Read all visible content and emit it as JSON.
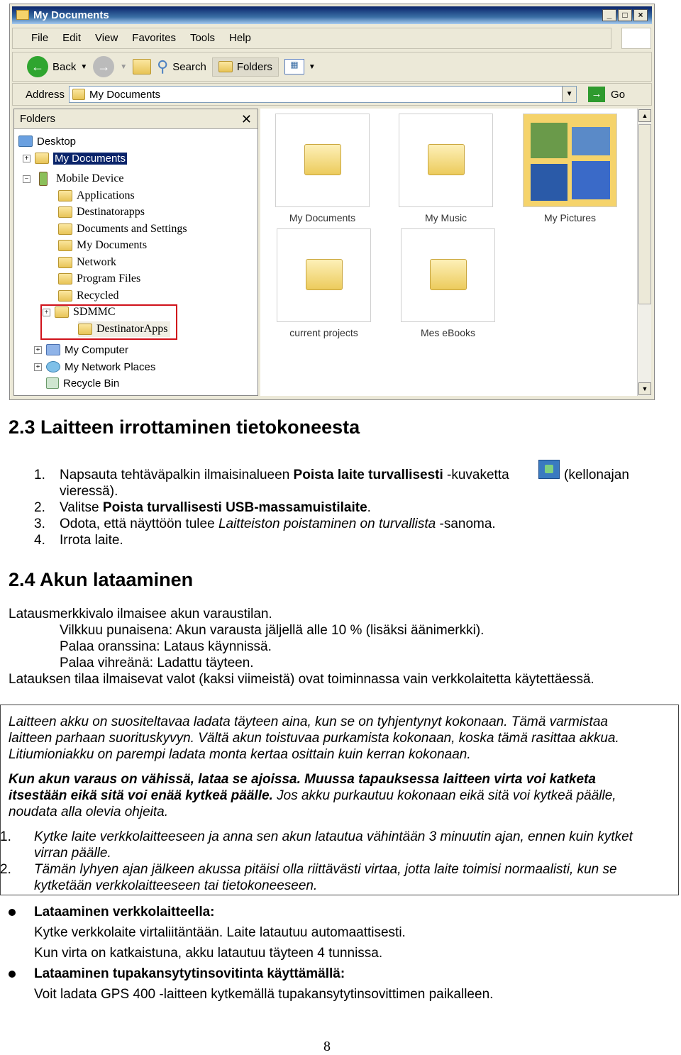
{
  "window": {
    "title": "My Documents",
    "min": "_",
    "max": "□",
    "close": "×",
    "menu": [
      "File",
      "Edit",
      "View",
      "Favorites",
      "Tools",
      "Help"
    ],
    "toolbar": {
      "back": "Back",
      "search": "Search",
      "folders": "Folders"
    },
    "address": {
      "label": "Address",
      "value": "My Documents",
      "go": "Go"
    },
    "folders_pane": {
      "title": "Folders",
      "close": "✕",
      "tree": {
        "desktop": "Desktop",
        "my_documents": "My Documents",
        "mobile_device": "Mobile Device",
        "children": [
          "Applications",
          "Destinatorapps",
          "Documents and Settings",
          "My Documents",
          "Network",
          "Program Files",
          "Recycled"
        ],
        "sdmmc": "SDMMC",
        "destinator_apps": "DestinatorApps",
        "my_computer": "My Computer",
        "my_network_places": "My Network Places",
        "recycle_bin": "Recycle Bin"
      }
    },
    "files": [
      "My Documents",
      "My Music",
      "My Pictures",
      "current projects",
      "Mes eBooks"
    ]
  },
  "section23": {
    "heading": "2.3 Laitteen irrottaminen tietokoneesta",
    "steps": [
      {
        "n": "1.",
        "a": "Napsauta tehtäväpalkin ilmaisinalueen ",
        "b": "Poista laite turvallisesti",
        "c": " -kuvaketta",
        "d": "(kellonajan",
        "e": "vieressä)."
      },
      {
        "n": "2.",
        "a": "Valitse ",
        "b": "Poista turvallisesti USB-massamuistilaite",
        "c": "."
      },
      {
        "n": "3.",
        "a": "Odota, että näyttöön tulee ",
        "i": "Laitteiston poistaminen on turvallista",
        "c": " -sanoma."
      },
      {
        "n": "4.",
        "a": "Irrota laite."
      }
    ]
  },
  "section24": {
    "heading": "2.4 Akun lataaminen",
    "lines": [
      "Latausmerkkivalo ilmaisee akun varaustilan.",
      "Vilkkuu punaisena: Akun varausta jäljellä alle 10 % (lisäksi äänimerkki).",
      "Palaa oranssina: Lataus käynnissä.",
      "Palaa vihreänä: Ladattu täyteen.",
      "Latauksen tilaa ilmaisevat valot (kaksi viimeistä) ovat toiminnassa vain verkkolaitetta käytettäessä."
    ]
  },
  "note": {
    "p1": [
      "Laitteen akku on suositeltavaa ladata täyteen aina, kun se on tyhjentynyt kokonaan. Tämä varmistaa",
      "laitteen parhaan suorituskyvyn. Vältä akun toistuvaa purkamista kokonaan, koska tämä rasittaa akkua.",
      "Litiumioniakku on parempi ladata monta kertaa osittain kuin kerran kokonaan."
    ],
    "p2_bold1": "Kun akun varaus on vähissä, lataa se ajoissa. Muussa tapauksessa laitteen virta voi katketa",
    "p2_bold2": "itsestään eikä sitä voi enää kytkeä päälle.",
    "p2_rest": "  Jos akku purkautuu kokonaan eikä sitä voi kytkeä päälle,",
    "p2_last": "noudata alla olevia ohjeita.",
    "steps": [
      {
        "n": "1.",
        "l1": "Kytke laite verkkolaitteeseen ja anna sen akun latautua vähintään 3 minuutin ajan, ennen kuin kytket",
        "l2": "virran päälle."
      },
      {
        "n": "2.",
        "l1": "Tämän lyhyen ajan jälkeen akussa pitäisi olla riittävästi virtaa, jotta laite toimisi normaalisti, kun se",
        "l2": "kytketään verkkolaitteeseen tai tietokoneeseen."
      }
    ]
  },
  "bullets": [
    {
      "title": "Lataaminen verkkolaitteella:",
      "lines": [
        "Kytke verkkolaite virtaliitäntään. Laite latautuu automaattisesti.",
        "Kun virta on katkaistuna, akku latautuu täyteen 4 tunnissa."
      ]
    },
    {
      "title": "Lataaminen tupakansytytinsovitinta käyttämällä:",
      "lines": [
        "Voit ladata GPS 400 -laitteen kytkemällä tupakansytytinsovittimen paikalleen."
      ]
    }
  ],
  "page_number": "8"
}
